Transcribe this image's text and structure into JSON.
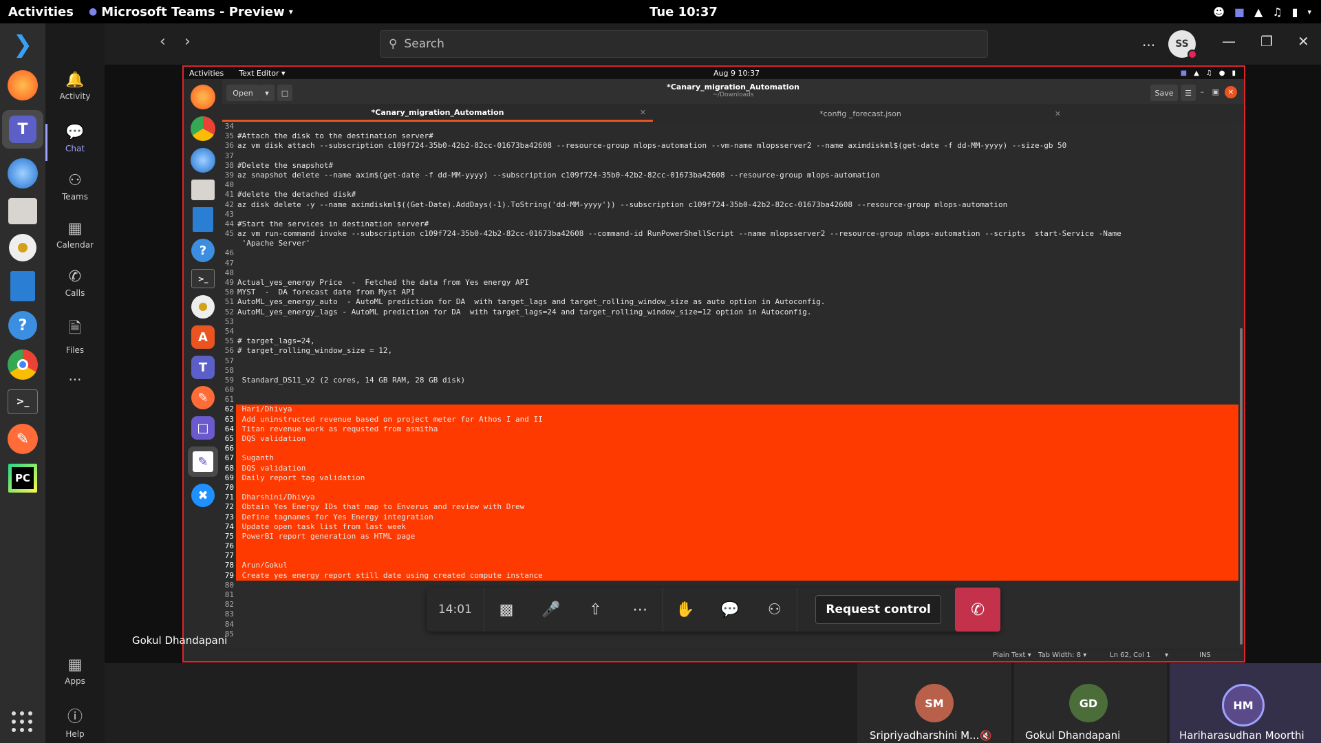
{
  "system": {
    "activities": "Activities",
    "app_name": "Microsoft Teams - Preview",
    "clock": "Tue 10:37"
  },
  "dock": {
    "icons": [
      "vscode-icon",
      "firefox-icon",
      "teams-icon",
      "thunderbird-icon",
      "files-icon",
      "rhythmbox-icon",
      "writer-icon",
      "help-icon",
      "chrome-icon",
      "terminal-icon",
      "postman-icon",
      "pycharm-icon"
    ]
  },
  "rail": {
    "items": [
      {
        "label": "Activity",
        "icon": "bell-icon"
      },
      {
        "label": "Chat",
        "icon": "chat-icon"
      },
      {
        "label": "Teams",
        "icon": "teams-icon"
      },
      {
        "label": "Calendar",
        "icon": "calendar-icon"
      },
      {
        "label": "Calls",
        "icon": "phone-icon"
      },
      {
        "label": "Files",
        "icon": "file-icon"
      }
    ],
    "more": "...",
    "apps": "Apps",
    "help": "Help"
  },
  "header": {
    "search_placeholder": "Search",
    "more": "...",
    "avatar_initials": "SS"
  },
  "shared": {
    "activities": "Activities",
    "text_editor": "Text Editor ▾",
    "clock": "Aug 9  10:37",
    "open": "Open",
    "title": "*Canary_migration_Automation",
    "subtitle": "~/Downloads",
    "save": "Save",
    "tab1": "*Canary_migration_Automation",
    "tab2": "*config _forecast.json",
    "status_plain": "Plain Text ▾",
    "status_tab": "Tab Width: 8 ▾",
    "status_pos": "Ln 62, Col 1",
    "status_ins": "INS"
  },
  "code_lines": [
    {
      "n": "34",
      "t": "",
      "hl": false
    },
    {
      "n": "35",
      "t": "#Attach the disk to the destination server#",
      "hl": false
    },
    {
      "n": "36",
      "t": "az vm disk attach --subscription c109f724-35b0-42b2-82cc-01673ba42608 --resource-group mlops-automation --vm-name mlopsserver2 --name aximdiskml$(get-date -f dd-MM-yyyy) --size-gb 50",
      "hl": false
    },
    {
      "n": "37",
      "t": "",
      "hl": false
    },
    {
      "n": "38",
      "t": "#Delete the snapshot#",
      "hl": false
    },
    {
      "n": "39",
      "t": "az snapshot delete --name axim$(get-date -f dd-MM-yyyy) --subscription c109f724-35b0-42b2-82cc-01673ba42608 --resource-group mlops-automation",
      "hl": false
    },
    {
      "n": "40",
      "t": "",
      "hl": false
    },
    {
      "n": "41",
      "t": "#delete the detached disk#",
      "hl": false
    },
    {
      "n": "42",
      "t": "az disk delete -y --name aximdiskml$((Get-Date).AddDays(-1).ToString('dd-MM-yyyy')) --subscription c109f724-35b0-42b2-82cc-01673ba42608 --resource-group mlops-automation",
      "hl": false
    },
    {
      "n": "43",
      "t": "",
      "hl": false
    },
    {
      "n": "44",
      "t": "#Start the services in destination server#",
      "hl": false
    },
    {
      "n": "45",
      "t": "az vm run-command invoke --subscription c109f724-35b0-42b2-82cc-01673ba42608 --command-id RunPowerShellScript --name mlopsserver2 --resource-group mlops-automation --scripts  start-Service -Name",
      "hl": false
    },
    {
      "n": "",
      "t": " 'Apache Server'",
      "hl": false
    },
    {
      "n": "46",
      "t": "",
      "hl": false
    },
    {
      "n": "47",
      "t": "",
      "hl": false
    },
    {
      "n": "48",
      "t": "",
      "hl": false
    },
    {
      "n": "49",
      "t": "Actual_yes_energy Price  -  Fetched the data from Yes energy API",
      "hl": false
    },
    {
      "n": "50",
      "t": "MYST  -  DA forecast date from Myst API",
      "hl": false
    },
    {
      "n": "51",
      "t": "AutoML_yes_energy_auto  - AutoML prediction for DA  with target_lags and target_rolling_window_size as auto option in Autoconfig.",
      "hl": false
    },
    {
      "n": "52",
      "t": "AutoML_yes_energy_lags - AutoML prediction for DA  with target_lags=24 and target_rolling_window_size=12 option in Autoconfig.",
      "hl": false
    },
    {
      "n": "53",
      "t": "",
      "hl": false
    },
    {
      "n": "54",
      "t": "",
      "hl": false
    },
    {
      "n": "55",
      "t": "# target_lags=24,",
      "hl": false
    },
    {
      "n": "56",
      "t": "# target_rolling_window_size = 12,",
      "hl": false
    },
    {
      "n": "57",
      "t": "",
      "hl": false
    },
    {
      "n": "58",
      "t": "",
      "hl": false
    },
    {
      "n": "59",
      "t": " Standard_DS11_v2 (2 cores, 14 GB RAM, 28 GB disk)",
      "hl": false
    },
    {
      "n": "60",
      "t": "",
      "hl": false
    },
    {
      "n": "61",
      "t": "",
      "hl": false
    },
    {
      "n": "62",
      "t": " Hari/Dhivya",
      "hl": true
    },
    {
      "n": "63",
      "t": " Add uninstructed revenue based on project meter for Athos I and II",
      "hl": true
    },
    {
      "n": "64",
      "t": " Titan revenue work as requsted from asmitha",
      "hl": true
    },
    {
      "n": "65",
      "t": " DQS validation",
      "hl": true
    },
    {
      "n": "66",
      "t": "",
      "hl": true
    },
    {
      "n": "67",
      "t": " Suganth",
      "hl": true
    },
    {
      "n": "68",
      "t": " DQS validation",
      "hl": true
    },
    {
      "n": "69",
      "t": " Daily report tag validation",
      "hl": true
    },
    {
      "n": "70",
      "t": "",
      "hl": true
    },
    {
      "n": "71",
      "t": " Dharshini/Dhivya",
      "hl": true
    },
    {
      "n": "72",
      "t": " Obtain Yes Energy IDs that map to Enverus and review with Drew",
      "hl": true
    },
    {
      "n": "73",
      "t": " Define tagnames for Yes Energy integration",
      "hl": true
    },
    {
      "n": "74",
      "t": " Update open task list from last week",
      "hl": true
    },
    {
      "n": "75",
      "t": " PowerBI report generation as HTML page",
      "hl": true
    },
    {
      "n": "76",
      "t": "",
      "hl": true
    },
    {
      "n": "77",
      "t": "",
      "hl": true
    },
    {
      "n": "78",
      "t": " Arun/Gokul",
      "hl": true
    },
    {
      "n": "79",
      "t": " Create yes energy report still date using created compute instance",
      "hl": true
    },
    {
      "n": "80",
      "t": "",
      "hl": false
    },
    {
      "n": "81",
      "t": "",
      "hl": false
    },
    {
      "n": "82",
      "t": "",
      "hl": false
    },
    {
      "n": "83",
      "t": "",
      "hl": false
    },
    {
      "n": "84",
      "t": "",
      "hl": false
    },
    {
      "n": "85",
      "t": "",
      "hl": false
    }
  ],
  "call": {
    "duration": "14:01",
    "request_control": "Request control",
    "presenter": "Gokul Dhandapani"
  },
  "participants": [
    {
      "name": "Sripriyadharshini M...",
      "muted": true,
      "color": "#b8604a"
    },
    {
      "name": "Gokul Dhandapani",
      "muted": false,
      "color": "#4a6d3a"
    },
    {
      "name": "Hariharasudhan Moorthi",
      "muted": false,
      "color": "#5a4a8a"
    }
  ],
  "colors": {
    "accent": "#9ea2ff",
    "share_border": "#e0242b",
    "highlight": "#ff3a00",
    "hangup": "#c4314b"
  }
}
